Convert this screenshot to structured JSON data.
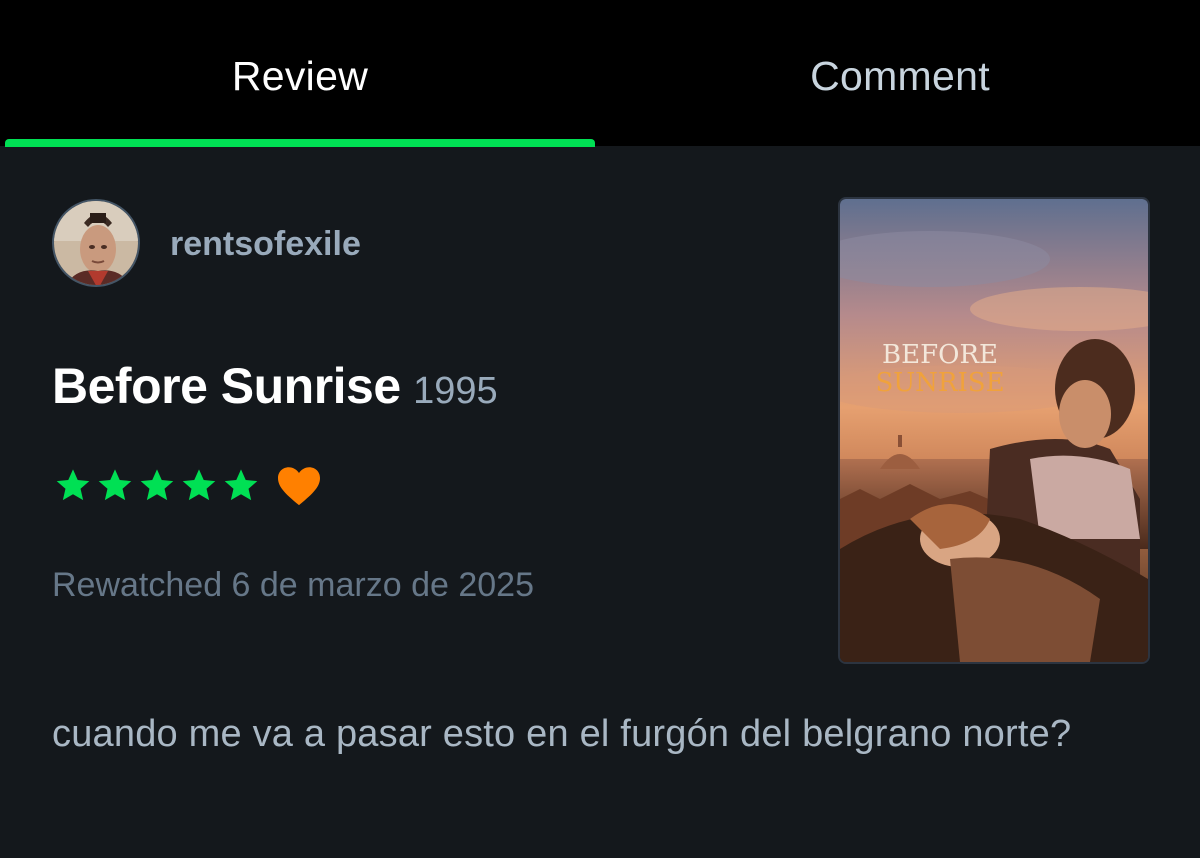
{
  "tabs": {
    "review_label": "Review",
    "comment_label": "Comment",
    "active": "Review"
  },
  "review": {
    "username": "rentsofexile",
    "film_title": "Before Sunrise",
    "film_year": "1995",
    "rating_stars": 5,
    "liked": true,
    "watched_status": "Rewatched 6 de marzo de 2025",
    "body": "cuando me va a pasar esto en el furgón del belgrano norte?"
  },
  "poster": {
    "title_line1": "BEFORE",
    "title_line2": "SUNRISE"
  },
  "colors": {
    "accent_green": "#00e054",
    "like_orange": "#ff8000",
    "background": "#14181c"
  },
  "icons": {
    "star": "star-icon",
    "heart": "heart-icon"
  }
}
